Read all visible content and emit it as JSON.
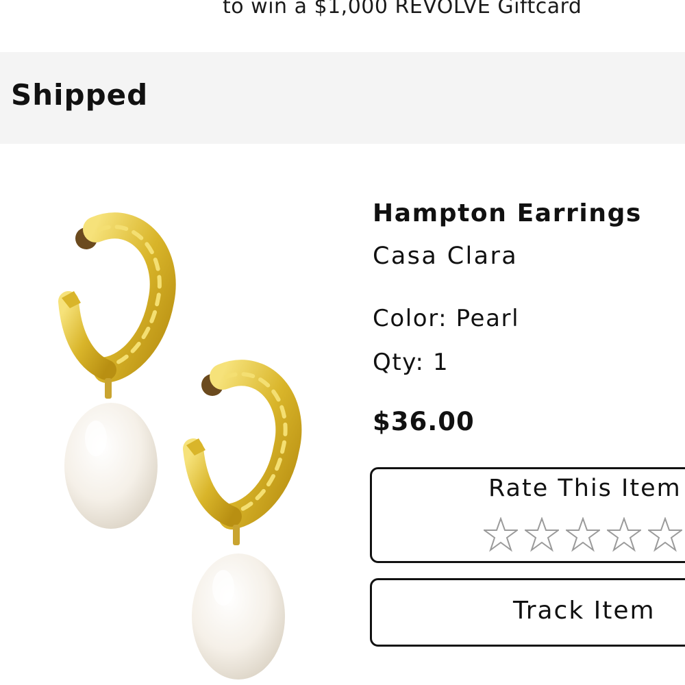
{
  "promo": {
    "text": "to win a $1,000 REVOLVE Giftcard"
  },
  "order": {
    "status": "Shipped"
  },
  "item": {
    "name": "Hampton Earrings",
    "brand": "Casa Clara",
    "color_label": "Color:",
    "color_value": "Pearl",
    "qty_label": "Qty:",
    "qty_value": "1",
    "price": "$36.00",
    "image_icon": "pearl-hoop-earrings-image"
  },
  "rating": {
    "label": "Rate This Item",
    "max_stars": 5,
    "selected": 0,
    "star_icon": "star-outline-icon"
  },
  "actions": {
    "track_label": "Track Item"
  },
  "colors": {
    "status_bar_bg": "#f4f4f4",
    "gold": "#d8b628",
    "pearl": "#f6f2ec",
    "star_stroke": "#9a9a9a"
  }
}
